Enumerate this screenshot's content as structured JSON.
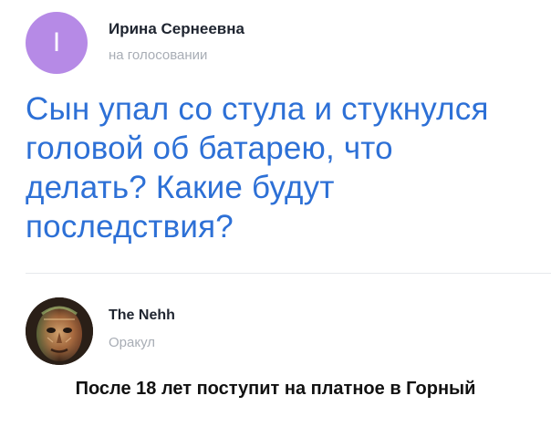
{
  "question": {
    "author": {
      "initial": "I",
      "name": "Ирина Сернеевна",
      "status": "на голосовании",
      "avatar_color": "#b68ae6"
    },
    "text_lines": [
      "Сын упал со стула и стукнулся",
      "головой об батарею, что",
      "делать? Какие будут",
      "последствия?"
    ],
    "text_color": "#2d70d6"
  },
  "answer": {
    "author": {
      "name": "The Nehh",
      "status": "Оракул",
      "avatar_icon": "face-portrait-icon"
    },
    "text": "После 18 лет поступит на платное в Горный"
  }
}
